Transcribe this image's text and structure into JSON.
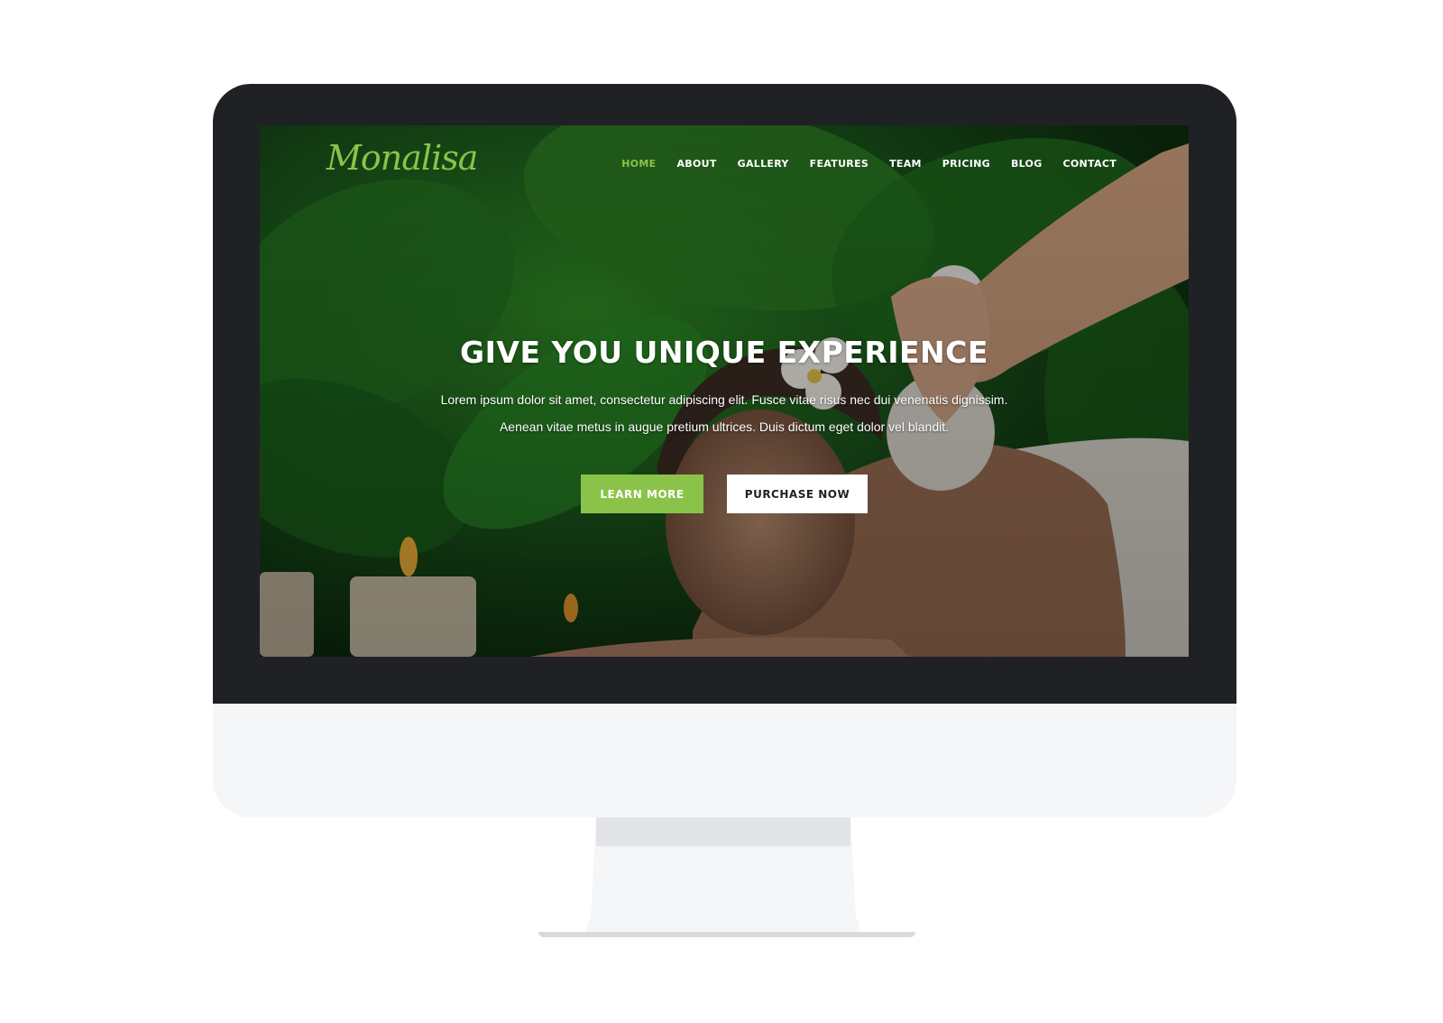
{
  "site": {
    "logo": "Monalisa",
    "nav": [
      {
        "label": "HOME",
        "active": true
      },
      {
        "label": "ABOUT"
      },
      {
        "label": "GALLERY"
      },
      {
        "label": "FEATURES"
      },
      {
        "label": "TEAM"
      },
      {
        "label": "PRICING"
      },
      {
        "label": "BLOG"
      },
      {
        "label": "CONTACT"
      }
    ]
  },
  "hero": {
    "title": "GIVE YOU UNIQUE EXPERIENCE",
    "line1": "Lorem ipsum dolor sit amet, consectetur adipiscing elit. Fusce vitae risus nec dui venenatis dignissim.",
    "line2": "Aenean vitae metus in augue pretium ultrices. Duis dictum eget dolor vel blandit.",
    "buttons": {
      "learn_more": "LEARN MORE",
      "purchase_now": "PURCHASE NOW"
    }
  },
  "colors": {
    "accent": "#8bc34a",
    "bezel": "#202125",
    "chin": "#f5f6f8"
  }
}
